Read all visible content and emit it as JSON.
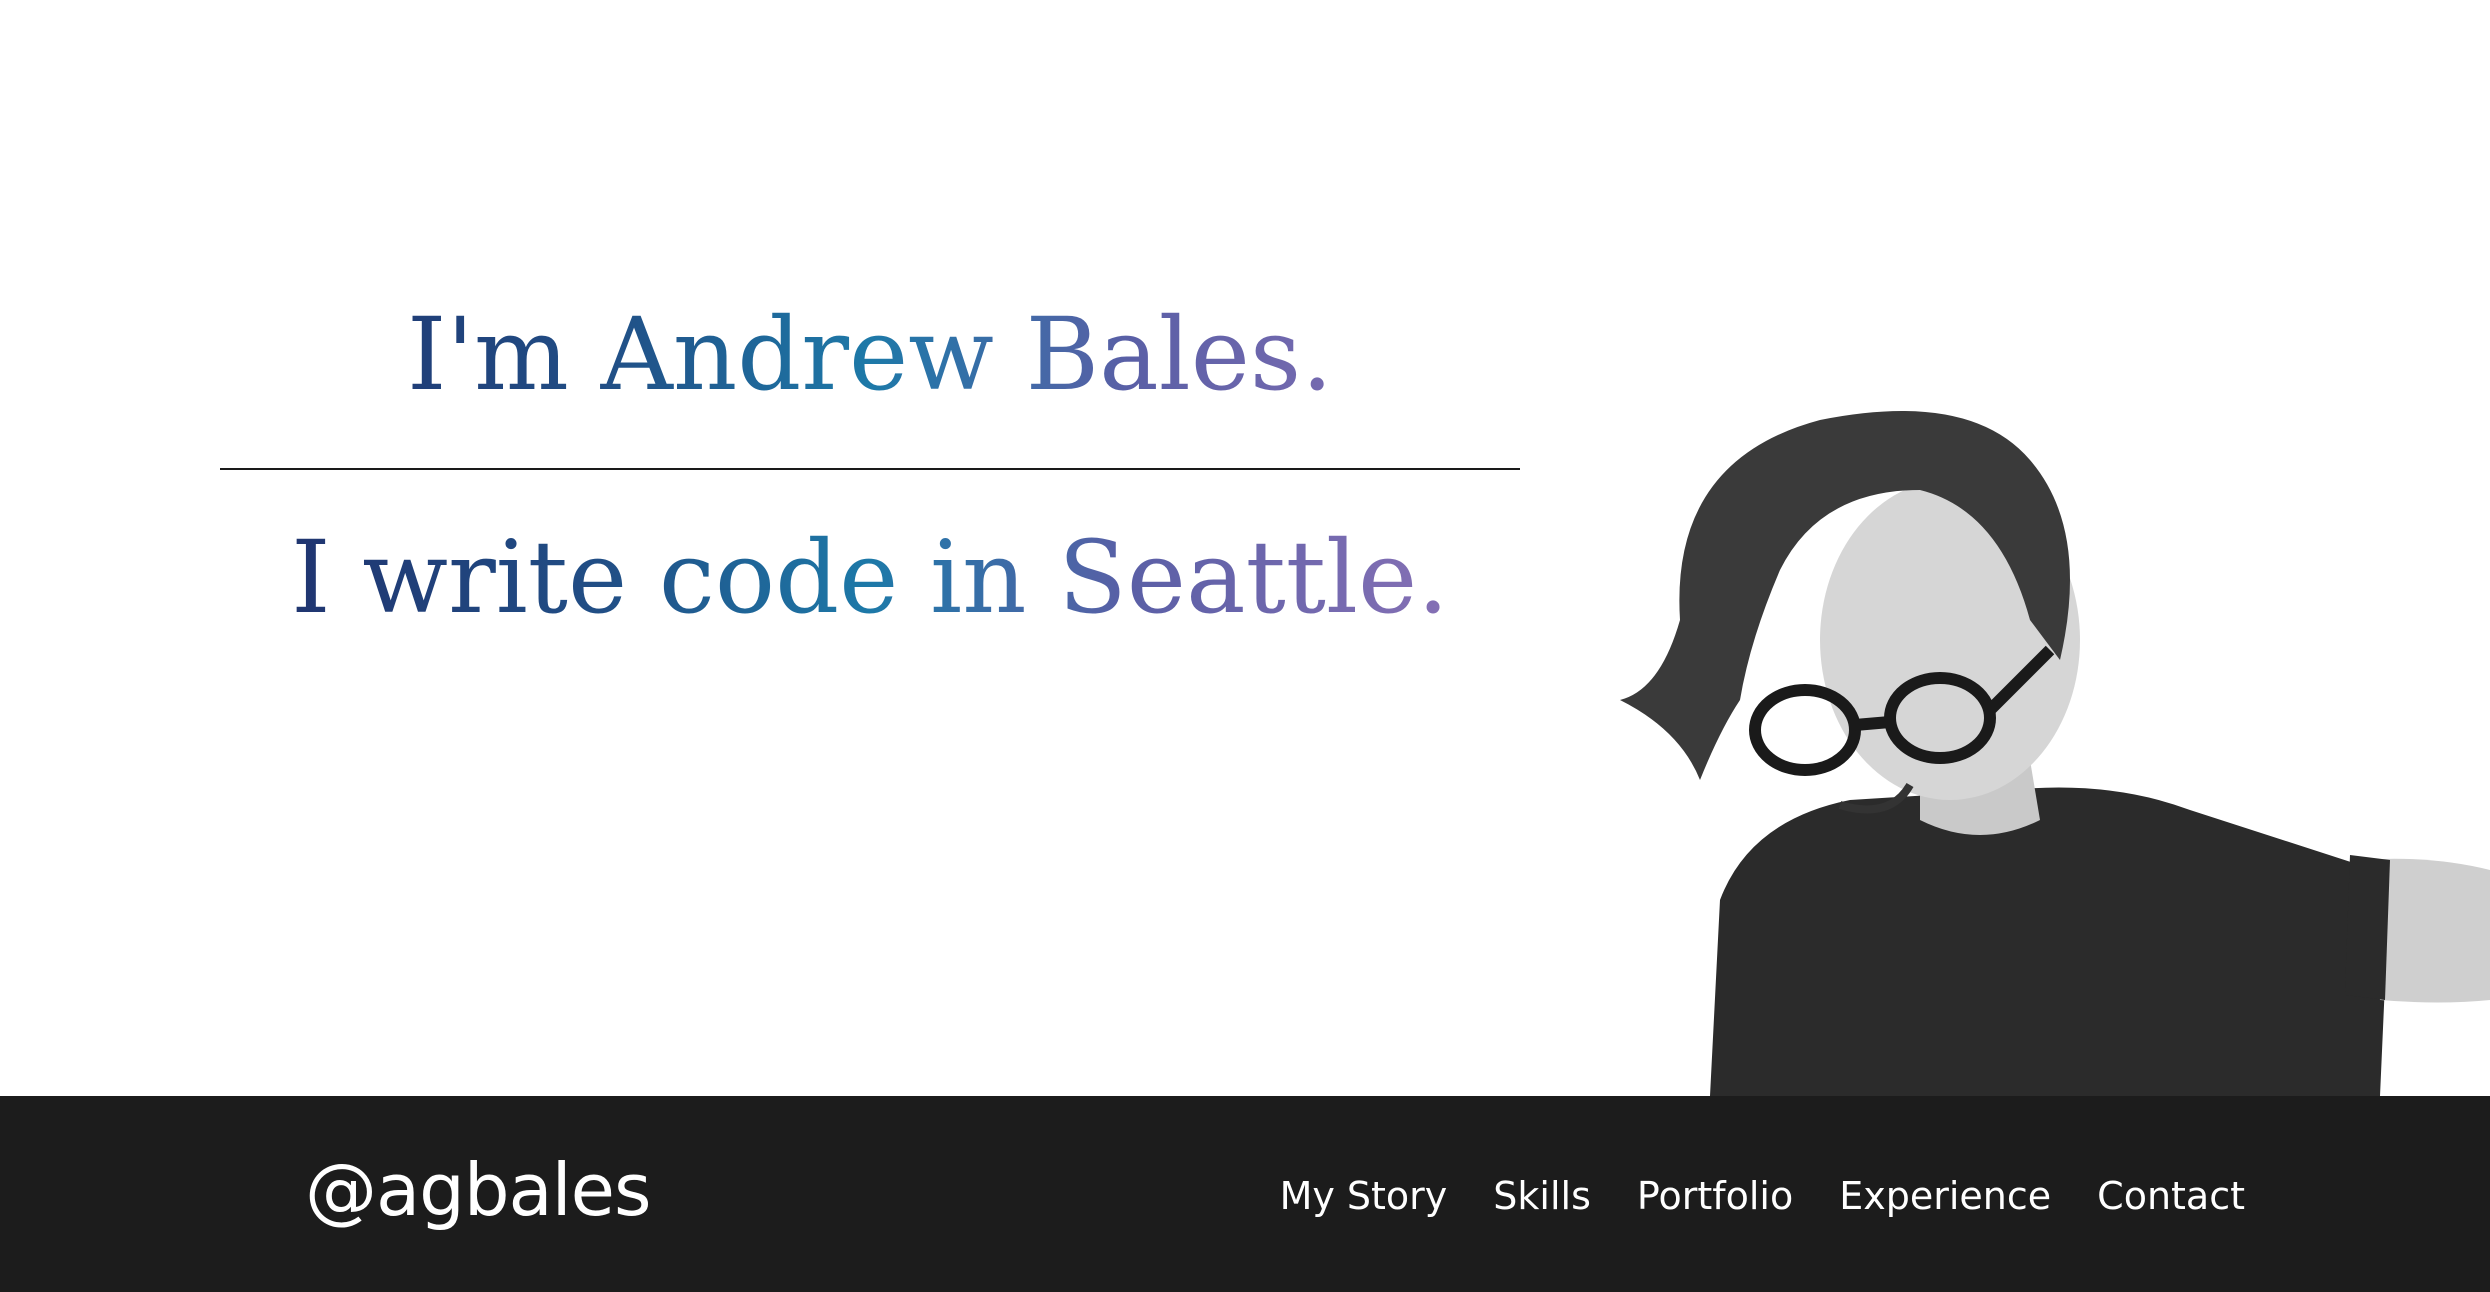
{
  "hero": {
    "headline_1": "I'm Andrew Bales.",
    "headline_2": "I write code in Seattle.",
    "gradient_colors": [
      "#1f2f6b",
      "#1d79a8",
      "#8f74b8"
    ]
  },
  "portrait": {
    "icon": "person-photo"
  },
  "footer": {
    "background": "#1c1c1c",
    "handle": "@agbales",
    "nav": [
      {
        "label": "My Story"
      },
      {
        "label": "Skills"
      },
      {
        "label": "Portfolio"
      },
      {
        "label": "Experience"
      },
      {
        "label": "Contact"
      }
    ]
  }
}
